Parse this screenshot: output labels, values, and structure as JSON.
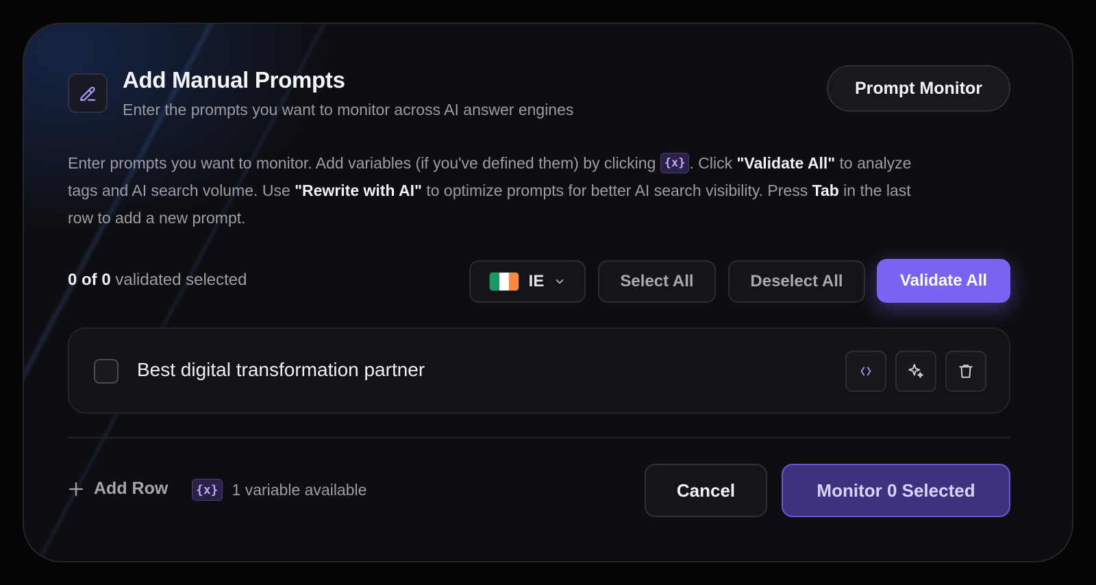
{
  "header": {
    "icon": "pencil-icon",
    "title": "Add Manual Prompts",
    "subtitle": "Enter the prompts you want to monitor across AI answer engines",
    "monitor_button": "Prompt Monitor"
  },
  "description": {
    "part1": "Enter prompts you want to monitor. Add variables (if you've defined them) by clicking ",
    "variable_chip": "{x}",
    "part2": ". Click ",
    "validate_all": "\"Validate All\"",
    "part3": " to analyze tags and AI search volume. Use ",
    "rewrite": "\"Rewrite with AI\"",
    "part4": " to optimize prompts for better AI search visibility. Press ",
    "tab": "Tab",
    "part5": " in the last row to add a new prompt."
  },
  "toolbar": {
    "count_strong": "0 of 0",
    "count_text": " validated selected",
    "country_code": "IE",
    "flag_colors": [
      "#169b62",
      "#ffffff",
      "#ff883e"
    ],
    "select_all": "Select All",
    "deselect_all": "Deselect All",
    "validate_all": "Validate All"
  },
  "prompts": [
    {
      "text": "Best digital transformation partner",
      "checked": false,
      "actions": [
        "variable-code-icon",
        "sparkles-icon",
        "trash-icon"
      ]
    }
  ],
  "footer": {
    "add_row": "Add Row",
    "variable_chip": "{x}",
    "variables_available": "1 variable available",
    "cancel": "Cancel",
    "submit": "Monitor 0 Selected"
  },
  "colors": {
    "accent": "#7a63f0",
    "submit_bg": "#3e3180",
    "background": "#0d0e11"
  }
}
